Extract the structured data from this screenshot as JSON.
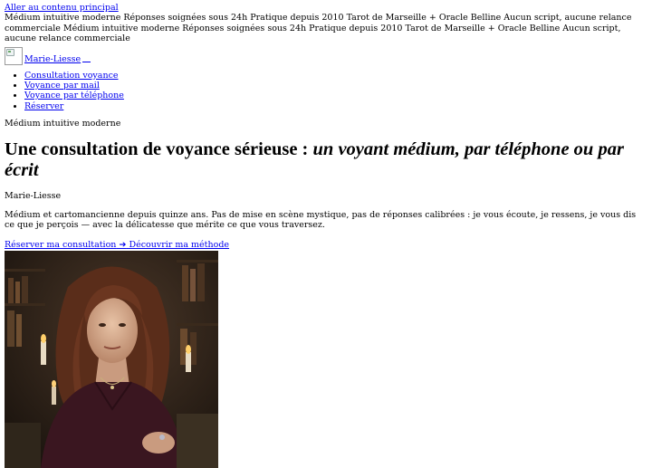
{
  "skip_link": "Aller au contenu principal",
  "ticker": "Médium intuitive moderne Réponses soignées sous 24h Pratique depuis 2010 Tarot de Marseille + Oracle Belline Aucun script, aucune relance commerciale Médium intuitive moderne Réponses soignées sous 24h Pratique depuis 2010 Tarot de Marseille + Oracle Belline Aucun script, aucune relance commerciale",
  "brand": {
    "name": "Marie-Liesse"
  },
  "nav": [
    {
      "label": "Consultation voyance"
    },
    {
      "label": "Voyance par mail"
    },
    {
      "label": "Voyance par téléphone"
    },
    {
      "label": "Réserver"
    }
  ],
  "hero": {
    "eyebrow": "Médium intuitive moderne",
    "title_main": "Une consultation de voyance sérieuse : ",
    "title_em": "un voyant médium, par téléphone ou par écrit",
    "author": "Marie-Liesse",
    "lead": "Médium et cartomancienne depuis quinze ans. Pas de mise en scène mystique, pas de réponses calibrées : je vous écoute, je ressens, je vous dis ce que je perçois — avec la délicatesse que mérite ce que vous traversez.",
    "cta_primary": "Réserver ma consultation",
    "cta_arrow": "➔",
    "cta_secondary": "Découvrir ma méthode"
  },
  "colors": {
    "link": "#0000ee",
    "text": "#000000",
    "photo_bg": "#2c1f16"
  }
}
